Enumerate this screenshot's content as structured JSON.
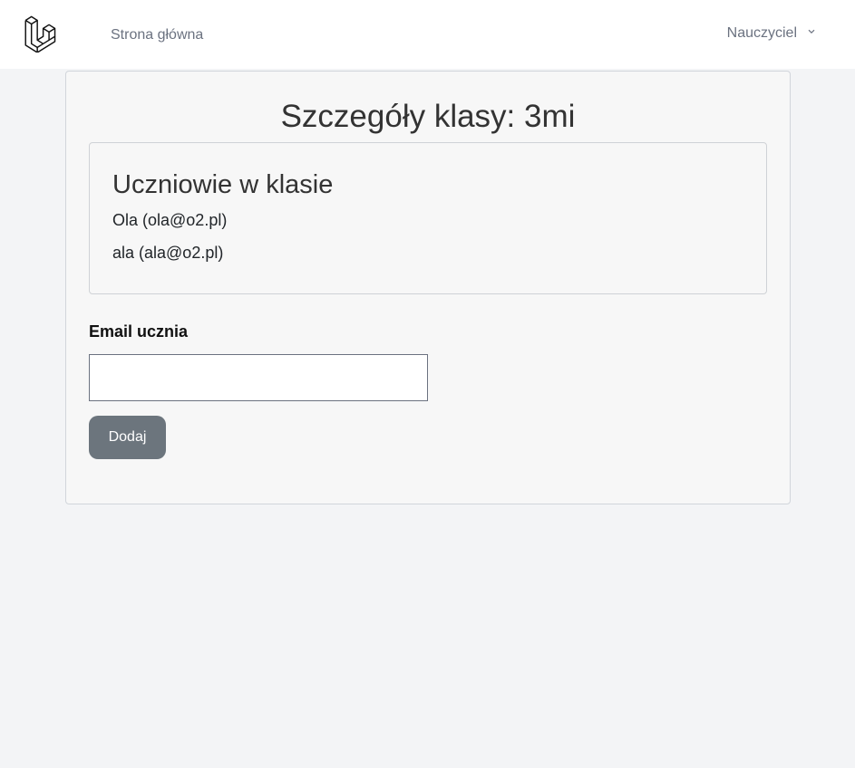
{
  "nav": {
    "logo_icon": "laravel-logo-icon",
    "home_link": "Strona główna",
    "user_menu": "Nauczyciel",
    "dropdown_icon": "chevron-down-icon"
  },
  "page": {
    "title": "Szczegóły klasy: 3mi"
  },
  "students": {
    "heading": "Uczniowie w klasie",
    "items": [
      "Ola (ola@o2.pl)",
      "ala (ala@o2.pl)"
    ]
  },
  "form": {
    "email_label": "Email ucznia",
    "email_value": "",
    "submit_label": "Dodaj"
  },
  "colors": {
    "page_background": "#f3f4f6",
    "card_background": "#f7f7f7",
    "button_background": "#6c757d"
  }
}
